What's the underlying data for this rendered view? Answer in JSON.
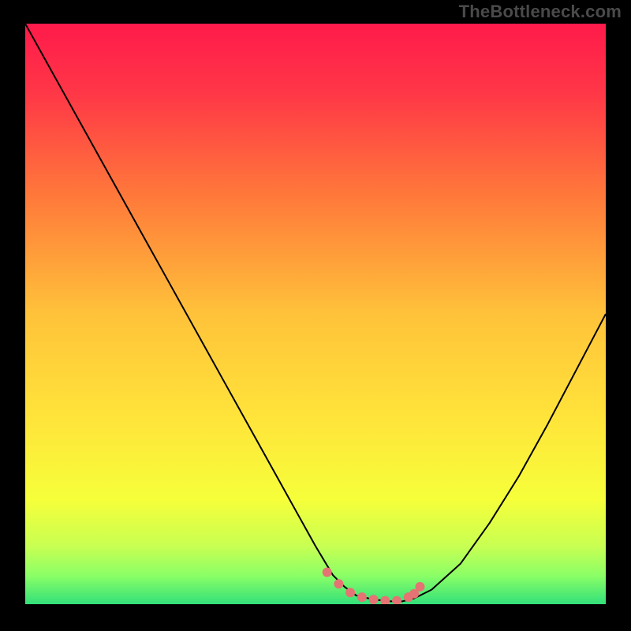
{
  "watermark": "TheBottleneck.com",
  "chart_data": {
    "type": "line",
    "title": "",
    "xlabel": "",
    "ylabel": "",
    "xlim": [
      0,
      100
    ],
    "ylim": [
      0,
      100
    ],
    "series": [
      {
        "name": "curve",
        "color": "#000000",
        "x": [
          0,
          5,
          10,
          15,
          20,
          25,
          30,
          35,
          40,
          45,
          50,
          53,
          55,
          57,
          60,
          63,
          65,
          67,
          70,
          75,
          80,
          85,
          90,
          95,
          100
        ],
        "y": [
          100,
          91,
          82,
          73,
          64,
          55,
          46,
          37,
          28,
          19,
          10,
          5,
          3,
          1.5,
          0.8,
          0.5,
          0.5,
          1,
          2.5,
          7,
          14,
          22,
          31,
          40.5,
          50
        ]
      },
      {
        "name": "highlight-dots",
        "color": "#e57373",
        "x": [
          52,
          54,
          56,
          58,
          60,
          62,
          64,
          66,
          67,
          68
        ],
        "y": [
          5.5,
          3.5,
          2,
          1.2,
          0.8,
          0.6,
          0.6,
          1.2,
          1.8,
          3
        ]
      }
    ],
    "gradient_stops": [
      {
        "offset": 0.0,
        "color": "#ff1a4b"
      },
      {
        "offset": 0.12,
        "color": "#ff3747"
      },
      {
        "offset": 0.3,
        "color": "#ff7a3a"
      },
      {
        "offset": 0.5,
        "color": "#ffc23a"
      },
      {
        "offset": 0.68,
        "color": "#ffe43a"
      },
      {
        "offset": 0.82,
        "color": "#f6ff3a"
      },
      {
        "offset": 0.9,
        "color": "#c8ff52"
      },
      {
        "offset": 0.95,
        "color": "#8cff66"
      },
      {
        "offset": 1.0,
        "color": "#33e07a"
      }
    ]
  }
}
